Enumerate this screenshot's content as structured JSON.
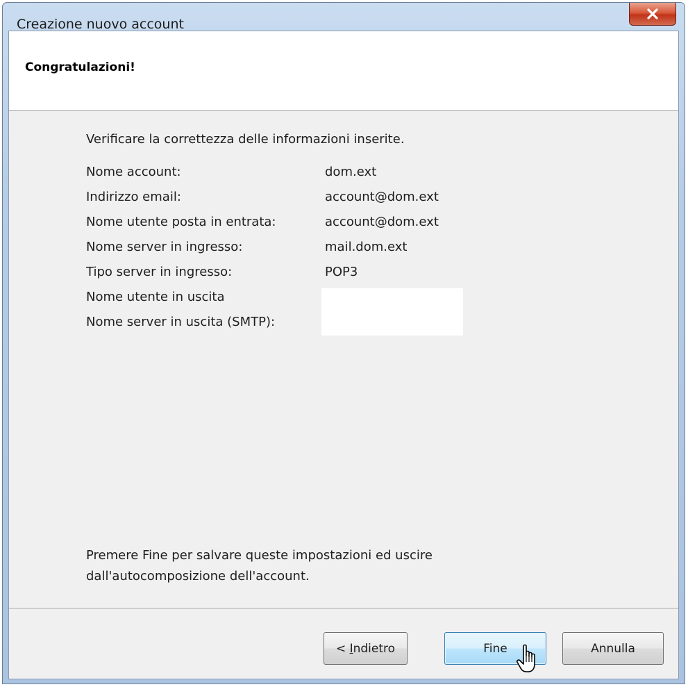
{
  "window": {
    "title": "Creazione nuovo account"
  },
  "header": {
    "title": "Congratulazioni!"
  },
  "main": {
    "intro": "Verificare la correttezza delle informazioni inserite.",
    "rows": [
      {
        "label": "Nome account:",
        "value": "dom.ext"
      },
      {
        "label": "Indirizzo email:",
        "value": "account@dom.ext"
      },
      {
        "label": "Nome utente posta in entrata:",
        "value": "account@dom.ext"
      },
      {
        "label": "Nome server in ingresso:",
        "value": "mail.dom.ext"
      },
      {
        "label": "Tipo server in ingresso:",
        "value": "POP3"
      },
      {
        "label": "Nome utente in uscita",
        "value": ""
      },
      {
        "label": "Nome server in uscita (SMTP):",
        "value": ""
      }
    ],
    "footer_line1": "Premere Fine per salvare queste impostazioni ed uscire",
    "footer_line2": "dall'autocomposizione dell'account."
  },
  "buttons": {
    "back_prefix": "< ",
    "back_mnemonic": "I",
    "back_rest": "ndietro",
    "finish": "Fine",
    "cancel": "Annulla"
  },
  "icons": {
    "close": "close-icon",
    "cursor": "hand-pointer-cursor-icon"
  }
}
